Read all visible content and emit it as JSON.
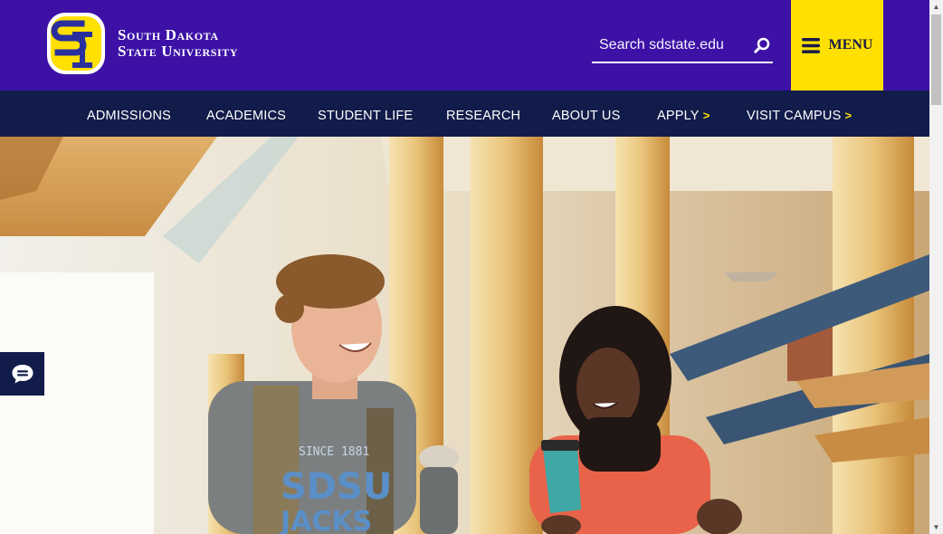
{
  "header": {
    "logo_line1": "South Dakota",
    "logo_line2": "State University",
    "search_placeholder": "Search sdstate.edu",
    "search_icon": "search-icon",
    "menu_label": "MENU",
    "menu_icon": "hamburger-icon"
  },
  "nav": {
    "items": [
      {
        "label": "ADMISSIONS",
        "arrow": ""
      },
      {
        "label": "ACADEMICS",
        "arrow": ""
      },
      {
        "label": "STUDENT LIFE",
        "arrow": ""
      },
      {
        "label": "RESEARCH",
        "arrow": ""
      },
      {
        "label": "ABOUT US",
        "arrow": ""
      },
      {
        "label": "APPLY",
        "arrow": ">"
      },
      {
        "label": "VISIT CAMPUS",
        "arrow": ">"
      }
    ]
  },
  "hero": {
    "shirt_text_top": "SINCE 1881",
    "shirt_text_mid": "SDSU",
    "shirt_text_bottom": "JACKS"
  },
  "chat": {
    "icon": "chat-bubble-icon"
  },
  "colors": {
    "header_bg": "#3d11a6",
    "nav_bg": "#111c4a",
    "accent_yellow": "#ffe000",
    "logo_blue": "#2a2f9e"
  }
}
